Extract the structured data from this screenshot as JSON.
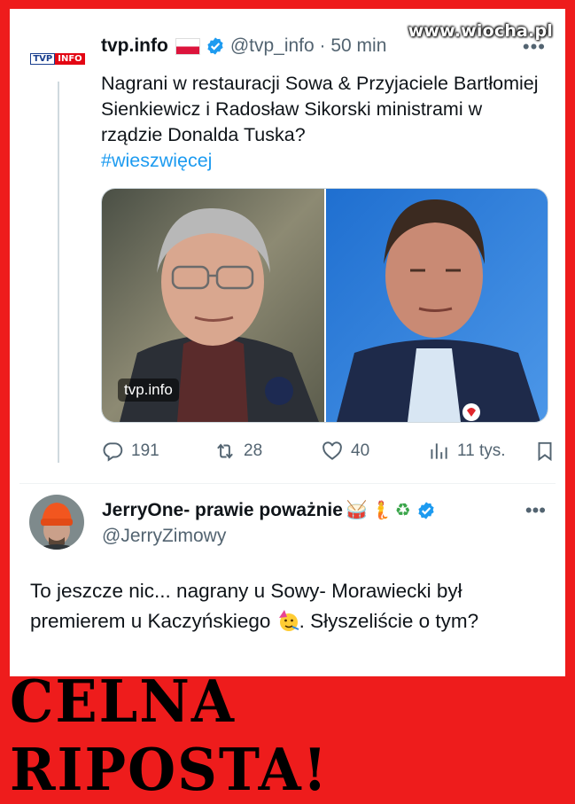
{
  "watermark": "www.wiocha.pl",
  "tweet1": {
    "avatar_logo_left": "TVP",
    "avatar_logo_right": "INFO",
    "name": "tvp.info",
    "handle_time": "@tvp_info · 50 min",
    "text": "Nagrani w restauracji Sowa & Przyjaciele Bartłomiej Sienkiewicz i Radosław Sikorski ministrami w rządzie Donalda Tuska?",
    "hashtag": "#wieszwięcej",
    "media_label": "tvp.info",
    "replies": "191",
    "retweets": "28",
    "likes": "40",
    "views": "11 tys."
  },
  "tweet2": {
    "name": "JerryOne- prawie poważnie",
    "handle": "@JerryZimowy",
    "text_a": "To jeszcze nic... nagrany u Sowy- Morawiecki był premierem u Kaczyńskiego ",
    "text_b": ". Słyszeliście o tym?"
  },
  "banner": "CELNA RIPOSTA!",
  "colors": {
    "frame": "#ee1c1c",
    "link": "#1d9bf0",
    "muted": "#536471",
    "text": "#0f1419"
  },
  "icons": [
    "verified-badge-icon",
    "reply-icon",
    "retweet-icon",
    "like-icon",
    "views-icon",
    "bookmark-icon",
    "more-icon",
    "drum-emoji",
    "mermaid-emoji",
    "recycle-emoji",
    "party-face-emoji"
  ]
}
